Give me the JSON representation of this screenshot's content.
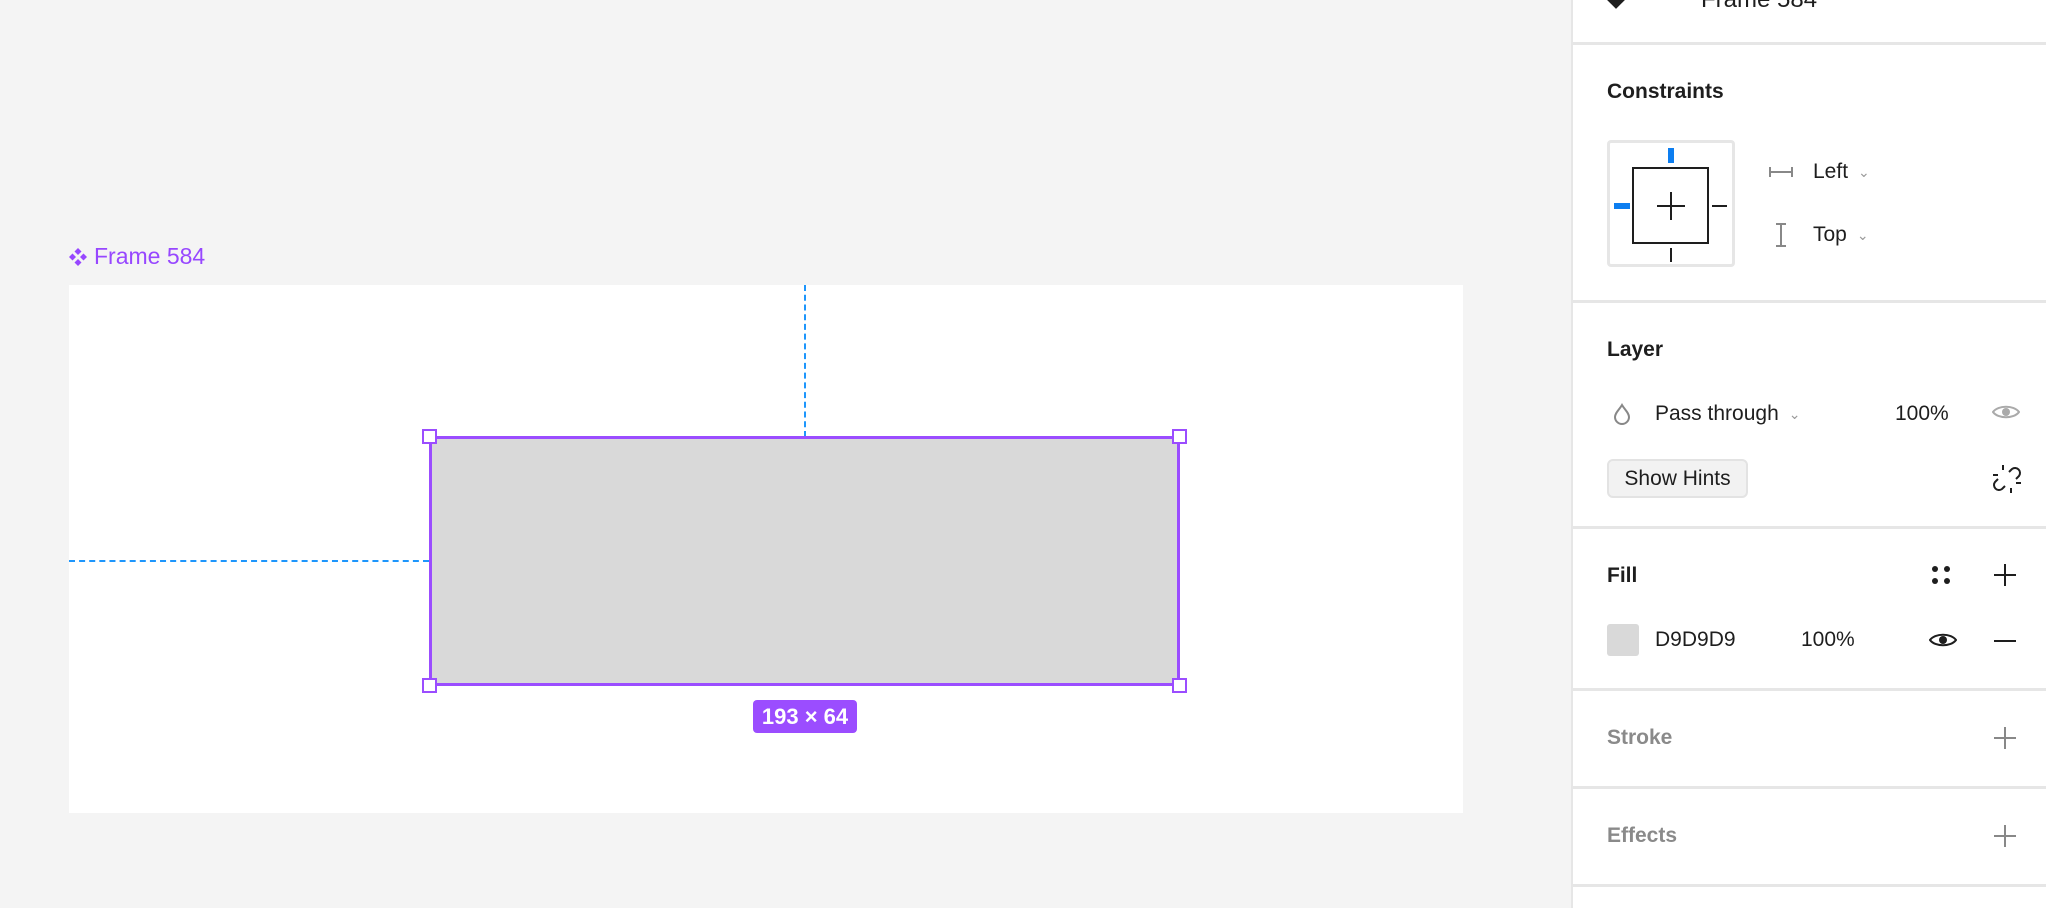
{
  "canvas": {
    "frame_name": "Frame 584",
    "dimensions": "193 × 64",
    "selection_color": "#9b4dff",
    "guide_color": "#1e96fc"
  },
  "panel": {
    "top_layer_name": "Frame 584",
    "constraints": {
      "title": "Constraints",
      "horizontal": "Left",
      "vertical": "Top"
    },
    "layer": {
      "title": "Layer",
      "blend_mode": "Pass through",
      "opacity": "100%",
      "show_hints": "Show Hints"
    },
    "fill": {
      "title": "Fill",
      "hex": "D9D9D9",
      "opacity": "100%",
      "color": "#d9d9d9"
    },
    "stroke": {
      "title": "Stroke"
    },
    "effects": {
      "title": "Effects"
    }
  }
}
